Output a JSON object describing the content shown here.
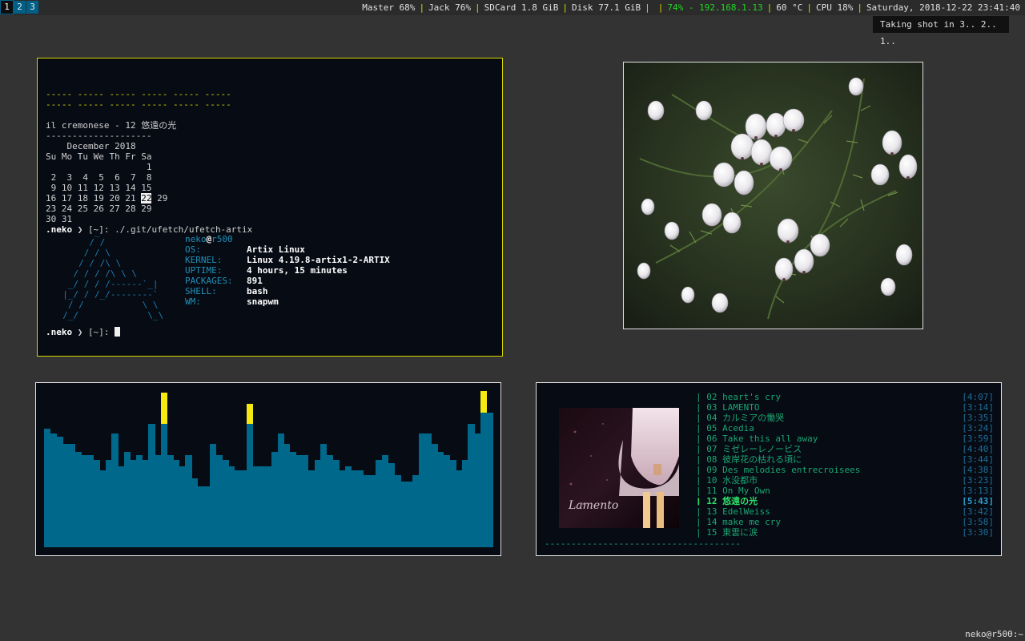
{
  "bar": {
    "workspaces": [
      "1",
      "2",
      "3"
    ],
    "status": {
      "master": "Master 68%",
      "jack": "Jack 76%",
      "sdcard": "SDCard 1.8 GiB",
      "disk": "Disk 77.1 GiB",
      "net": "74% - 192.168.1.13",
      "temp": "60 °C",
      "cpu": "CPU 18%",
      "datetime": "Saturday, 2018-12-22 23:41:40"
    },
    "notification": "Taking shot in 3.. 2.. 1.."
  },
  "terminal": {
    "palette_line": "----- ----- ----- ----- ----- -----",
    "now_playing": "il cremonese - 12 悠遠の光",
    "rule": "--------------------",
    "cal_title": "    December 2018",
    "cal_header": "Su Mo Tu We Th Fr Sa",
    "cal_row1": "                   1",
    "cal_row2": " 2  3  4  5  6  7  8",
    "cal_row3": " 9 10 11 12 13 14 15",
    "cal_row4_pre": "16 17 18 19 20 21 ",
    "cal_today": "22",
    "cal_row5": "23 24 25 26 27 28 29",
    "cal_row6": "30 31",
    "prompt_user": ".neko",
    "prompt_rest": " ❯ [~]: ",
    "command": "./.git/ufetch/ufetch-artix",
    "logo": [
      "        _",
      "       / /",
      "      / / \\",
      "     / / /\\ \\",
      "    / / / /\\ \\ \\",
      "   _/ / / /------`_|",
      "  |_/ / /_/--------`",
      "   / /           \\ \\",
      "  /_/             \\_\\"
    ],
    "fetch_user": "neko",
    "fetch_at": "@",
    "fetch_host": "r500",
    "fetch": [
      {
        "key": "OS:",
        "value": "Artix Linux"
      },
      {
        "key": "KERNEL:",
        "value": "Linux 4.19.8-artix1-2-ARTIX"
      },
      {
        "key": "UPTIME:",
        "value": "4 hours, 15 minutes"
      },
      {
        "key": "PACKAGES:",
        "value": "891"
      },
      {
        "key": "SHELL:",
        "value": "bash"
      },
      {
        "key": "WM:",
        "value": "snapwm"
      }
    ]
  },
  "visualizer": {
    "levels": [
      0.76,
      0.73,
      0.71,
      0.66,
      0.66,
      0.61,
      0.59,
      0.59,
      0.56,
      0.49,
      0.56,
      0.73,
      0.52,
      0.61,
      0.56,
      0.59,
      0.56,
      0.79,
      0.59,
      0.79,
      0.59,
      0.56,
      0.52,
      0.59,
      0.44,
      0.39,
      0.39,
      0.66,
      0.59,
      0.56,
      0.52,
      0.49,
      0.49,
      0.79,
      0.52,
      0.52,
      0.52,
      0.61,
      0.73,
      0.66,
      0.61,
      0.59,
      0.59,
      0.49,
      0.56,
      0.66,
      0.59,
      0.56,
      0.49,
      0.52,
      0.49,
      0.49,
      0.46,
      0.46,
      0.56,
      0.59,
      0.54,
      0.46,
      0.42,
      0.42,
      0.46,
      0.73,
      0.73,
      0.66,
      0.61,
      0.59,
      0.56,
      0.49,
      0.56,
      0.79,
      0.73,
      0.86,
      0.86
    ],
    "peaks": [
      0.99,
      0.92,
      1.0
    ],
    "peak_columns": [
      19,
      33,
      71
    ]
  },
  "player": {
    "cover_text": "Lamento",
    "tracks": [
      {
        "num": "02",
        "title": "heart's cry",
        "duration": "[4:07]"
      },
      {
        "num": "03",
        "title": "LAMENTO",
        "duration": "[3:14]"
      },
      {
        "num": "04",
        "title": "カルミアの慟哭",
        "duration": "[3:35]"
      },
      {
        "num": "05",
        "title": "Acedia",
        "duration": "[3:24]"
      },
      {
        "num": "06",
        "title": "Take this all away",
        "duration": "[3:59]"
      },
      {
        "num": "07",
        "title": "ミゼレーレノービス",
        "duration": "[4:40]"
      },
      {
        "num": "08",
        "title": "彼岸花の枯れる頃に",
        "duration": "[3:44]"
      },
      {
        "num": "09",
        "title": "Des melodies entrecroisees",
        "duration": "[4:38]"
      },
      {
        "num": "10",
        "title": "水没都市",
        "duration": "[3:23]"
      },
      {
        "num": "11",
        "title": "On My Own",
        "duration": "[3:13]"
      },
      {
        "num": "12",
        "title": "悠遠の光",
        "duration": "[5:43]",
        "current": true
      },
      {
        "num": "13",
        "title": "EdelWeiss",
        "duration": "[3:42]"
      },
      {
        "num": "14",
        "title": "make me cry",
        "duration": "[3:58]"
      },
      {
        "num": "15",
        "title": "東雲に涙",
        "duration": "[3:30]"
      }
    ],
    "progress_rule": "-------------------------------------"
  },
  "corner_prompt": "neko@r500:~"
}
